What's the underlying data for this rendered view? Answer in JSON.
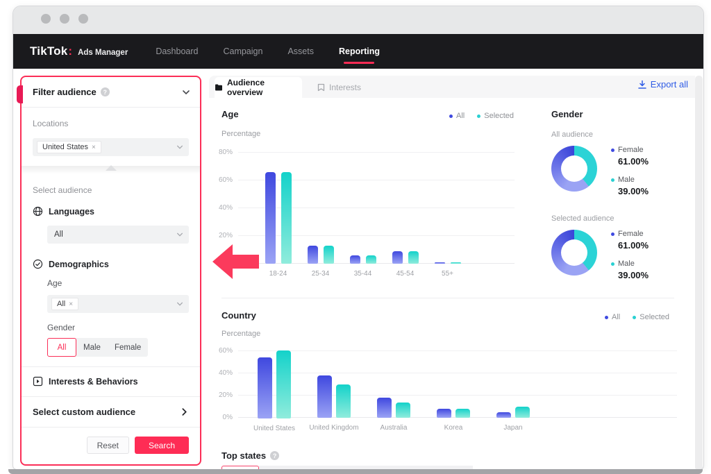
{
  "navbar": {
    "logo": "TikTok",
    "logo_colon": ":",
    "product": "Ads Manager",
    "items": [
      {
        "label": "Dashboard",
        "active": false
      },
      {
        "label": "Campaign",
        "active": false
      },
      {
        "label": "Assets",
        "active": false
      },
      {
        "label": "Reporting",
        "active": true
      }
    ]
  },
  "sidebar": {
    "title": "Filter audience",
    "sections": {
      "locations_label": "Locations",
      "location_chip": "United States",
      "chip_remove": "×",
      "select_audience_label": "Select audience",
      "languages_label": "Languages",
      "languages_value": "All",
      "demographics_label": "Demographics",
      "age_label": "Age",
      "age_chip": "All",
      "gender_label": "Gender",
      "gender_options": [
        {
          "label": "All",
          "selected": true
        },
        {
          "label": "Male",
          "selected": false
        },
        {
          "label": "Female",
          "selected": false
        }
      ],
      "interests_label": "Interests & Behaviors",
      "custom_audience_label": "Select custom audience"
    },
    "footer": {
      "reset_label": "Reset",
      "search_label": "Search"
    }
  },
  "main": {
    "tabs": [
      {
        "label": "Audience overview",
        "active": true
      },
      {
        "label": "Interests",
        "active": false
      }
    ],
    "export_label": "Export all",
    "top_states_label": "Top states"
  },
  "colors": {
    "accent_pink": "#fe2c55",
    "arrow_red": "#fb3a5c",
    "all_series_top": "#3f48df",
    "all_series_bottom": "#9ba3f5",
    "selected_series_top": "#14d2ca",
    "selected_series_bottom": "#90ecdc",
    "legend_dot_all": "#3f4ae0",
    "legend_dot_selected": "#2ad0d2",
    "donut_teal": "#2bd3d6",
    "donut_blue_dark": "#3a44d8",
    "donut_blue_light": "#9aa3f4",
    "export_blue": "#2e5be5"
  },
  "chart_data": [
    {
      "type": "bar",
      "title": "Age",
      "ylabel": "Percentage",
      "legend": [
        "All",
        "Selected"
      ],
      "legend_position": "top-right",
      "grid": true,
      "categories": [
        "18-24",
        "25-34",
        "35-44",
        "45-54",
        "55+"
      ],
      "series": [
        {
          "name": "All",
          "values": [
            66,
            13,
            6,
            9,
            1
          ]
        },
        {
          "name": "Selected",
          "values": [
            66,
            13,
            6,
            9,
            1
          ]
        }
      ],
      "yticks": [
        {
          "label": "80%",
          "value": 80
        },
        {
          "label": "60%",
          "value": 60
        },
        {
          "label": "40%",
          "value": 40
        },
        {
          "label": "20%",
          "value": 20
        }
      ],
      "ylim": [
        0,
        80
      ]
    },
    {
      "type": "pie",
      "title": "Gender",
      "groups": [
        {
          "label": "All audience",
          "slices": [
            {
              "name": "Female",
              "value": 61,
              "display": "61.00%"
            },
            {
              "name": "Male",
              "value": 39,
              "display": "39.00%"
            }
          ]
        },
        {
          "label": "Selected audience",
          "slices": [
            {
              "name": "Female",
              "value": 61,
              "display": "61.00%"
            },
            {
              "name": "Male",
              "value": 39,
              "display": "39.00%"
            }
          ]
        }
      ]
    },
    {
      "type": "bar",
      "title": "Country",
      "ylabel": "Percentage",
      "legend": [
        "All",
        "Selected"
      ],
      "legend_position": "top-right",
      "grid": true,
      "categories": [
        "United States",
        "United Kingdom",
        "Australia",
        "Korea",
        "Japan"
      ],
      "series": [
        {
          "name": "All",
          "values": [
            55,
            38,
            18,
            8,
            5
          ]
        },
        {
          "name": "Selected",
          "values": [
            61,
            30,
            14,
            8,
            10
          ]
        }
      ],
      "yticks": [
        {
          "label": "60%",
          "value": 60
        },
        {
          "label": "40%",
          "value": 40
        },
        {
          "label": "20%",
          "value": 20
        },
        {
          "label": "0%",
          "value": 0
        }
      ],
      "ylim": [
        0,
        60
      ]
    }
  ]
}
